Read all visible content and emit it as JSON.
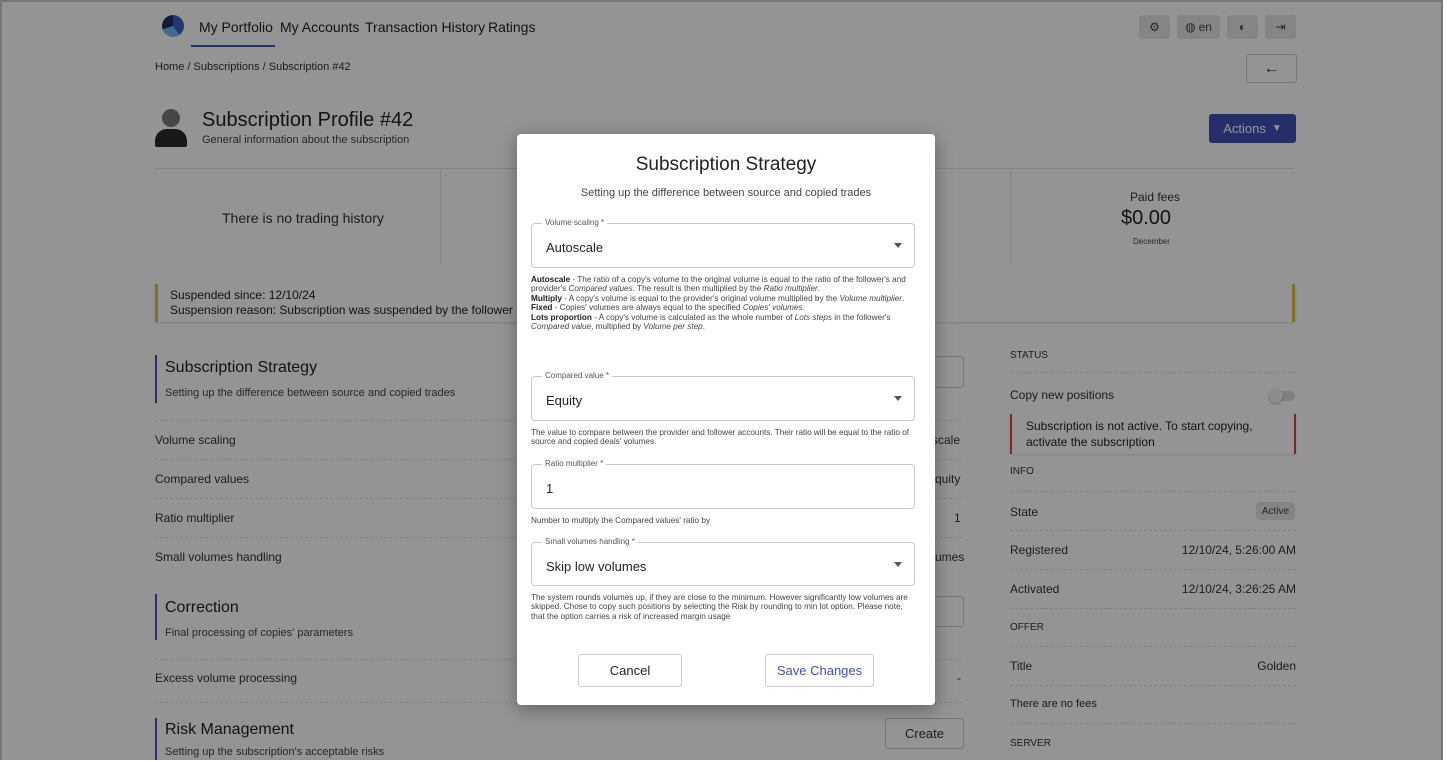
{
  "nav": {
    "tabs": [
      "My Portfolio",
      "My Accounts",
      "Transaction History",
      "Ratings"
    ],
    "lang_label": "en"
  },
  "breadcrumb": {
    "home": "Home",
    "subscriptions": "Subscriptions",
    "current": "Subscription #42"
  },
  "profile": {
    "title": "Subscription Profile #42",
    "subtitle": "General information about the subscription",
    "actions_label": "Actions"
  },
  "stats": {
    "no_history": "There is no trading history",
    "paid_fees_label": "Paid fees",
    "paid_fees_value": "$0.00",
    "paid_fees_period": "December"
  },
  "suspension": {
    "since": "Suspended since: 12/10/24",
    "reason": "Suspension reason: Subscription was suspended by the follower"
  },
  "strategy": {
    "title": "Subscription Strategy",
    "subtitle": "Setting up the difference between source and copied trades",
    "rows": [
      {
        "label": "Volume scaling",
        "value": "scale"
      },
      {
        "label": "Compared values",
        "value": "quity"
      },
      {
        "label": "Ratio multiplier",
        "value": "1"
      },
      {
        "label": "Small volumes handling",
        "value": "umes"
      }
    ]
  },
  "correction": {
    "title": "Correction",
    "subtitle": "Final processing of copies' parameters",
    "rows": [
      {
        "label": "Excess volume processing",
        "value": "-"
      }
    ]
  },
  "risk": {
    "title": "Risk Management",
    "subtitle": "Setting up the subscription's acceptable risks",
    "button": "Create"
  },
  "right_panel": {
    "status_head": "STATUS",
    "copy_new_positions": "Copy new positions",
    "not_active_msg": "Subscription is not active. To start copying, activate the subscription",
    "info_head": "INFO",
    "state_label": "State",
    "state_badge": "Active",
    "registered_label": "Registered",
    "registered_value": "12/10/24, 5:26:00 AM",
    "activated_label": "Activated",
    "activated_value": "12/10/24, 3:26:25 AM",
    "offer_head": "OFFER",
    "title_label": "Title",
    "title_value": "Golden",
    "no_fees": "There are no fees",
    "server_head": "SERVER"
  },
  "modal": {
    "title": "Subscription Strategy",
    "subtitle": "Setting up the difference between source and copied trades",
    "volume_scaling": {
      "label": "Volume scaling *",
      "value": "Autoscale",
      "help": {
        "autoscale_name": "Autoscale",
        "autoscale_t1": " - The ratio of a copy's volume to the original volume is equal to the ratio of the follower's and provider's ",
        "autoscale_em1": "Compared values",
        "autoscale_t2": ". The result is then multiplied by the ",
        "autoscale_em2": "Ratio multiplier",
        "autoscale_t3": ".",
        "multiply_name": "Multiply",
        "multiply_t1": " - A copy's volume is equal to the provider's original volume multiplied by the ",
        "multiply_em1": "Volume multiplier",
        "multiply_t2": ".",
        "fixed_name": "Fixed",
        "fixed_t1": " - Copies' volumes are always equal to the specified ",
        "fixed_em1": "Copies' volumes",
        "fixed_t2": ".",
        "lots_name": "Lots proportion",
        "lots_t1": " - A copy's volume is calculated as the whole number of ",
        "lots_em1": "Lots steps",
        "lots_t2": " in the follower's ",
        "lots_em2": "Compared value",
        "lots_t3": ", multiplied by ",
        "lots_em3": "Volume per step",
        "lots_t4": "."
      }
    },
    "compared_value": {
      "label": "Compared value *",
      "value": "Equity",
      "help": "The value to compare between the provider and follower accounts. Their ratio will be equal to the ratio of source and copied deals' volumes."
    },
    "ratio_multiplier": {
      "label": "Ratio multiplier *",
      "value": "1",
      "help": "Number to multiply the Compared values' ratio by"
    },
    "small_volumes": {
      "label": "Small volumes handling *",
      "value": "Skip low volumes",
      "help": "The system rounds volumes up, if they are close to the minimum. However significantly low volumes are skipped. Chose to copy such positions by selecting the Risk by rounding to min lot option. Please note, that the option carries a risk of increased margin usage"
    },
    "cancel_label": "Cancel",
    "save_label": "Save Changes"
  },
  "colors": {
    "accent": "#3f51b5",
    "warning": "#e0c341",
    "danger": "#d9463b"
  }
}
